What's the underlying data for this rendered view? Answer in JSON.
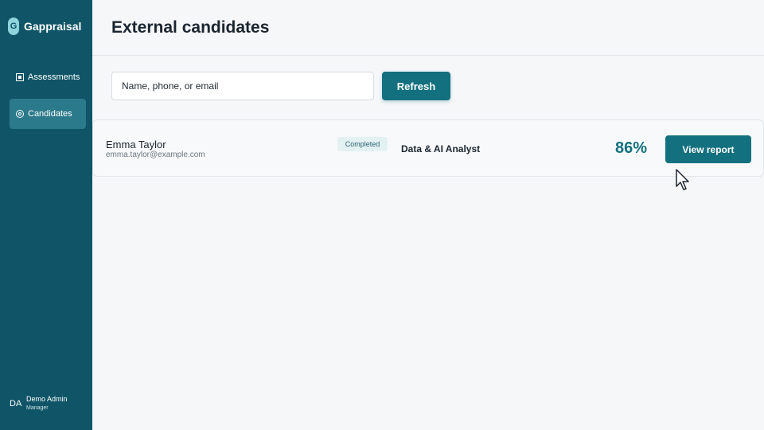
{
  "brand": {
    "logo_letter": "G",
    "name": "Gappraisal"
  },
  "sidebar": {
    "items": [
      {
        "label": "Assessments",
        "icon": "assessment-icon",
        "active": false
      },
      {
        "label": "Candidates",
        "icon": "candidates-icon",
        "active": true
      }
    ]
  },
  "user": {
    "initials": "DA",
    "name": "Demo Admin",
    "role": "Manager"
  },
  "header": {
    "title": "External candidates"
  },
  "search": {
    "placeholder": "Name, phone, or email",
    "value": ""
  },
  "toolbar": {
    "refresh_label": "Refresh"
  },
  "candidates": [
    {
      "name": "Emma Taylor",
      "email": "emma.taylor@example.com",
      "status": "Completed",
      "role": "Data & AI Analyst",
      "score": "86%",
      "action_label": "View report"
    }
  ],
  "colors": {
    "sidebar_bg": "#0f5567",
    "accent": "#13707f",
    "active_nav_bg": "#2b7a8b",
    "page_bg": "#f5f7f9"
  }
}
